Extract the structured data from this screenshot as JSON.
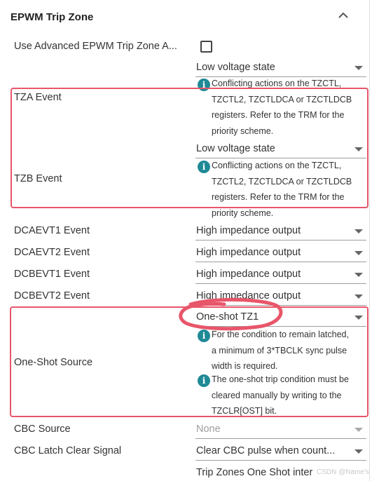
{
  "header": {
    "title": "EPWM Trip Zone",
    "collapse_icon": "chevron-up-icon"
  },
  "advanced": {
    "label": "Use Advanced EPWM Trip Zone A...",
    "checked": false
  },
  "tza": {
    "label": "TZA Event",
    "value": "Low voltage state",
    "info": [
      "Conflicting actions on the TZCTL,",
      "TZCTL2, TZCTLDCA or TZCTLDCB",
      "registers. Refer to the TRM for the",
      "priority scheme."
    ]
  },
  "tzb": {
    "label": "TZB Event",
    "value": "Low voltage state",
    "info": [
      "Conflicting actions on the TZCTL,",
      "TZCTL2, TZCTLDCA or TZCTLDCB",
      "registers. Refer to the TRM for the",
      "priority scheme."
    ]
  },
  "events": [
    {
      "label": "DCAEVT1 Event",
      "value": "High impedance output"
    },
    {
      "label": "DCAEVT2 Event",
      "value": "High impedance output"
    },
    {
      "label": "DCBEVT1 Event",
      "value": "High impedance output"
    },
    {
      "label": "DCBEVT2 Event",
      "value": "High impedance output"
    }
  ],
  "one_shot": {
    "label": "One-Shot Source",
    "value": "One-shot TZ1",
    "info1": [
      "For the condition to remain latched,",
      "a minimum of 3*TBCLK sync pulse",
      "width is required."
    ],
    "info2": [
      "The one-shot trip condition must be",
      "cleared manually by writing to the",
      "TZCLR[OST] bit."
    ]
  },
  "cbc_source": {
    "label": "CBC Source",
    "value": "None"
  },
  "cbc_latch": {
    "label": "CBC Latch Clear Signal",
    "value": "Clear CBC pulse when count..."
  },
  "trip_zones": {
    "value": "Trip Zones One Shot inter"
  },
  "watermark": "CSDN @Name's",
  "colors": {
    "highlight": "#e8566a",
    "info": "#1f8a96"
  }
}
